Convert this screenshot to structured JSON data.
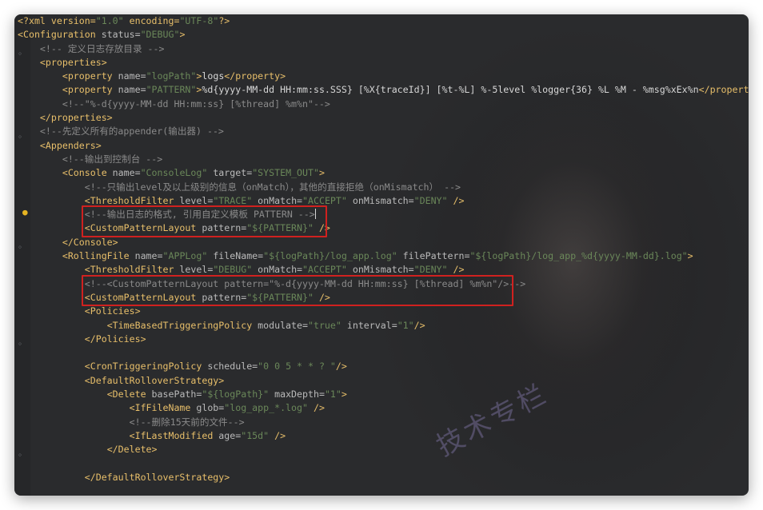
{
  "editor": {
    "lines": [
      {
        "indent": 0,
        "parts": [
          [
            "pi",
            "<?xml version="
          ],
          [
            "val",
            "\"1.0\""
          ],
          [
            "pi",
            " encoding="
          ],
          [
            "val",
            "\"UTF-8\""
          ],
          [
            "pi",
            "?>"
          ]
        ]
      },
      {
        "indent": 0,
        "parts": [
          [
            "tag",
            "<Configuration"
          ],
          [
            "attr",
            " status="
          ],
          [
            "val",
            "\"DEBUG\""
          ],
          [
            "tag",
            ">"
          ]
        ]
      },
      {
        "indent": 4,
        "parts": [
          [
            "cmt",
            "<!-- 定义日志存放目录 -->"
          ]
        ]
      },
      {
        "indent": 4,
        "parts": [
          [
            "tag",
            "<properties>"
          ]
        ]
      },
      {
        "indent": 8,
        "parts": [
          [
            "tag",
            "<property"
          ],
          [
            "attr",
            " name="
          ],
          [
            "val",
            "\"logPath\""
          ],
          [
            "tag",
            ">"
          ],
          [
            "txt",
            "logs"
          ],
          [
            "tag",
            "</property>"
          ]
        ]
      },
      {
        "indent": 8,
        "parts": [
          [
            "tag",
            "<property"
          ],
          [
            "attr",
            " name="
          ],
          [
            "val",
            "\"PATTERN\""
          ],
          [
            "tag",
            ">"
          ],
          [
            "txt",
            "%d{yyyy-MM-dd HH:mm:ss.SSS} [%X{traceId}] [%t-%L] %-5level %logger{36} %L %M - %msg%xEx%n"
          ],
          [
            "tag",
            "</property>"
          ]
        ]
      },
      {
        "indent": 8,
        "parts": [
          [
            "cmt",
            "<!--\"%-d{yyyy-MM-dd HH:mm:ss} [%thread] %m%n\"-->"
          ]
        ]
      },
      {
        "indent": 4,
        "parts": [
          [
            "tag",
            "</properties>"
          ]
        ]
      },
      {
        "indent": 4,
        "parts": [
          [
            "cmt",
            "<!--先定义所有的appender(输出器) -->"
          ]
        ]
      },
      {
        "indent": 4,
        "parts": [
          [
            "tag",
            "<Appenders>"
          ]
        ]
      },
      {
        "indent": 8,
        "parts": [
          [
            "cmt",
            "<!--输出到控制台 -->"
          ]
        ]
      },
      {
        "indent": 8,
        "parts": [
          [
            "tag",
            "<Console"
          ],
          [
            "attr",
            " name="
          ],
          [
            "val",
            "\"ConsoleLog\""
          ],
          [
            "attr",
            " target="
          ],
          [
            "val",
            "\"SYSTEM_OUT\""
          ],
          [
            "tag",
            ">"
          ]
        ]
      },
      {
        "indent": 12,
        "parts": [
          [
            "cmt",
            "<!--只输出level及以上级别的信息（onMatch），其他的直接拒绝（onMismatch） -->"
          ]
        ]
      },
      {
        "indent": 12,
        "parts": [
          [
            "tag",
            "<ThresholdFilter"
          ],
          [
            "attr",
            " level="
          ],
          [
            "val",
            "\"TRACE\""
          ],
          [
            "attr",
            " onMatch="
          ],
          [
            "val",
            "\"ACCEPT\""
          ],
          [
            "attr",
            " onMismatch="
          ],
          [
            "val",
            "\"DENY\""
          ],
          [
            "tag",
            " />"
          ]
        ]
      },
      {
        "indent": 12,
        "parts": [
          [
            "cmt",
            "<!--输出日志的格式, 引用自定义模板 PATTERN -->"
          ]
        ],
        "caret": true
      },
      {
        "indent": 12,
        "parts": [
          [
            "tag",
            "<CustomPatternLayout"
          ],
          [
            "attr",
            " pattern="
          ],
          [
            "val",
            "\"${PATTERN}\""
          ],
          [
            "tag",
            " />"
          ]
        ]
      },
      {
        "indent": 8,
        "parts": [
          [
            "tag",
            "</Console>"
          ]
        ]
      },
      {
        "indent": 8,
        "parts": [
          [
            "tag",
            "<RollingFile"
          ],
          [
            "attr",
            " name="
          ],
          [
            "val",
            "\"APPLog\""
          ],
          [
            "attr",
            " fileName="
          ],
          [
            "val",
            "\"${logPath}/log_app.log\""
          ],
          [
            "attr",
            " filePattern="
          ],
          [
            "val",
            "\"${logPath}/log_app_%d{yyyy-MM-dd}.log\""
          ],
          [
            "tag",
            ">"
          ]
        ]
      },
      {
        "indent": 12,
        "parts": [
          [
            "tag",
            "<ThresholdFilter"
          ],
          [
            "attr",
            " level="
          ],
          [
            "val",
            "\"DEBUG\""
          ],
          [
            "attr",
            " onMatch="
          ],
          [
            "val",
            "\"ACCEPT\""
          ],
          [
            "attr",
            " onMismatch="
          ],
          [
            "val",
            "\"DENY\""
          ],
          [
            "tag",
            " />"
          ]
        ]
      },
      {
        "indent": 12,
        "parts": [
          [
            "cmt",
            "<!--<CustomPatternLayout pattern=\"%-d{yyyy-MM-dd HH:mm:ss} [%thread] %m%n\"/>-->"
          ]
        ]
      },
      {
        "indent": 12,
        "parts": [
          [
            "tag",
            "<CustomPatternLayout"
          ],
          [
            "attr",
            " pattern="
          ],
          [
            "val",
            "\"${PATTERN}\""
          ],
          [
            "tag",
            " />"
          ]
        ]
      },
      {
        "indent": 12,
        "parts": [
          [
            "tag",
            "<Policies>"
          ]
        ]
      },
      {
        "indent": 16,
        "parts": [
          [
            "tag",
            "<TimeBasedTriggeringPolicy"
          ],
          [
            "attr",
            " modulate="
          ],
          [
            "val",
            "\"true\""
          ],
          [
            "attr",
            " interval="
          ],
          [
            "val",
            "\"1\""
          ],
          [
            "tag",
            "/>"
          ]
        ]
      },
      {
        "indent": 12,
        "parts": [
          [
            "tag",
            "</Policies>"
          ]
        ]
      },
      {
        "indent": 0,
        "parts": []
      },
      {
        "indent": 12,
        "parts": [
          [
            "tag",
            "<CronTriggeringPolicy"
          ],
          [
            "attr",
            " schedule="
          ],
          [
            "val",
            "\"0 0 5 * * ? \""
          ],
          [
            "tag",
            "/>"
          ]
        ]
      },
      {
        "indent": 12,
        "parts": [
          [
            "tag",
            "<DefaultRolloverStrategy>"
          ]
        ]
      },
      {
        "indent": 16,
        "parts": [
          [
            "tag",
            "<Delete"
          ],
          [
            "attr",
            " basePath="
          ],
          [
            "val",
            "\"${logPath}\""
          ],
          [
            "attr",
            " maxDepth="
          ],
          [
            "val",
            "\"1\""
          ],
          [
            "tag",
            ">"
          ]
        ]
      },
      {
        "indent": 20,
        "parts": [
          [
            "tag",
            "<IfFileName"
          ],
          [
            "attr",
            " glob="
          ],
          [
            "val",
            "\"log_app_*.log\""
          ],
          [
            "tag",
            " />"
          ]
        ]
      },
      {
        "indent": 20,
        "parts": [
          [
            "cmt",
            "<!--删除15天前的文件-->"
          ]
        ]
      },
      {
        "indent": 20,
        "parts": [
          [
            "tag",
            "<IfLastModified"
          ],
          [
            "attr",
            " age="
          ],
          [
            "val",
            "\"15d\""
          ],
          [
            "tag",
            " />"
          ]
        ]
      },
      {
        "indent": 16,
        "parts": [
          [
            "tag",
            "</Delete>"
          ]
        ]
      },
      {
        "indent": 0,
        "parts": []
      },
      {
        "indent": 12,
        "parts": [
          [
            "tag",
            "</DefaultRolloverStrategy>"
          ]
        ]
      }
    ]
  },
  "watermark": "技术专栏",
  "colors": {
    "tag": "#e8bf6a",
    "attribute": "#bababa",
    "value": "#6a8759",
    "comment": "#8a8a8a",
    "highlight": "#d0211f"
  }
}
